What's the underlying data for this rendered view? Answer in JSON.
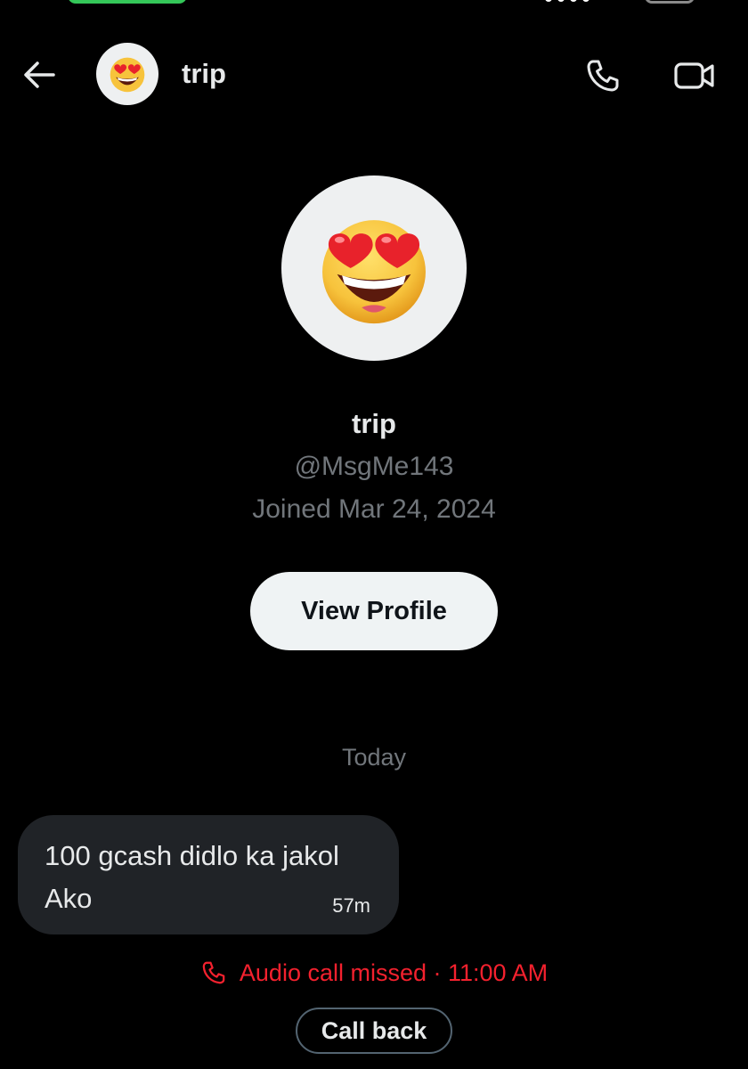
{
  "header": {
    "name": "trip",
    "back_icon": "arrow-left-icon",
    "call_icon": "phone-icon",
    "video_icon": "video-camera-icon"
  },
  "profile": {
    "avatar_icon": "heart-eyes-emoji",
    "name": "trip",
    "handle": "@MsgMe143",
    "joined": "Joined Mar 24, 2024",
    "view_profile_label": "View Profile"
  },
  "conversation": {
    "date_divider": "Today",
    "messages": [
      {
        "text": "100 gcash didlo ka jakol\nAko",
        "time": "57m"
      }
    ],
    "missed_call": {
      "icon": "phone-missed-icon",
      "text": "Audio call missed · 11:00 AM"
    },
    "call_back_label": "Call back"
  },
  "colors": {
    "background": "#000000",
    "primary_text": "#e7e9ea",
    "secondary_text": "#71767b",
    "bubble": "#202327",
    "missed_red": "#f4212e",
    "button_light": "#eff3f4"
  }
}
